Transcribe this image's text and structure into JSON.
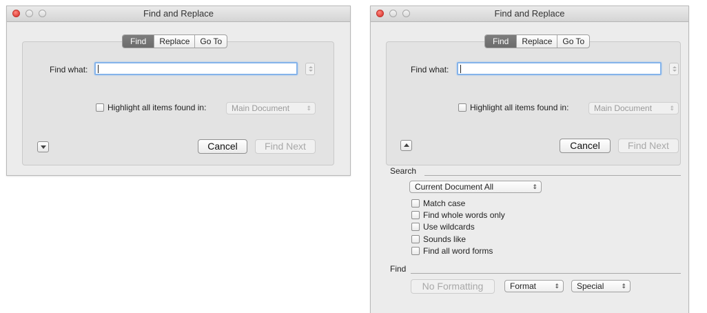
{
  "collapsed_dialog": {
    "title": "Find and Replace",
    "tabs": [
      "Find",
      "Replace",
      "Go To"
    ],
    "find_what_label": "Find what:",
    "find_what_value": "",
    "highlight_label": "Highlight all items found in:",
    "highlight_scope": "Main Document",
    "cancel_label": "Cancel",
    "find_next_label": "Find Next"
  },
  "expanded_dialog": {
    "title": "Find and Replace",
    "tabs": [
      "Find",
      "Replace",
      "Go To"
    ],
    "find_what_label": "Find what:",
    "find_what_value": "",
    "highlight_label": "Highlight all items found in:",
    "highlight_scope": "Main Document",
    "cancel_label": "Cancel",
    "find_next_label": "Find Next",
    "search_section_label": "Search",
    "search_scope": "Current Document All",
    "options": [
      "Match case",
      "Find whole words only",
      "Use wildcards",
      "Sounds like",
      "Find all word forms"
    ],
    "find_section_label": "Find",
    "no_formatting_label": "No Formatting",
    "format_label": "Format",
    "special_label": "Special"
  },
  "colors": {
    "window_bg": "#ececec",
    "close_button": "#e0443e",
    "focus_ring": "#84b3ea",
    "active_tab": "#6f6f6f"
  }
}
